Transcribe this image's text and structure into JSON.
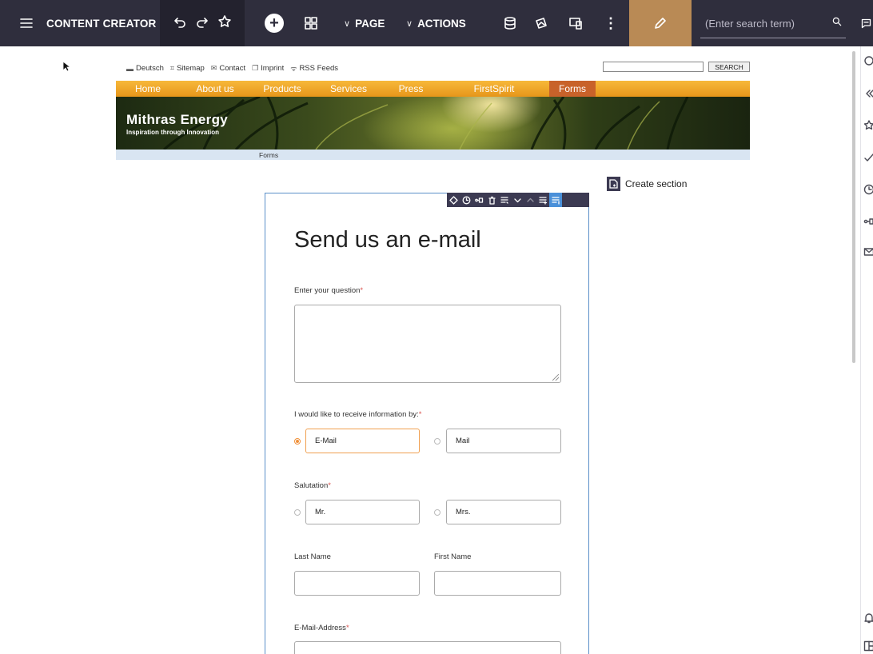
{
  "toolbar": {
    "app_title": "CONTENT CREATOR",
    "page_menu": "PAGE",
    "actions_menu": "ACTIONS",
    "search_placeholder": "(Enter search term)",
    "plus_label": "+",
    "more_label": "⋮",
    "chevron": "∨"
  },
  "site": {
    "meta_nav": [
      "Deutsch",
      "Sitemap",
      "Contact",
      "Imprint",
      "RSS Feeds"
    ],
    "search_button": "SEARCH",
    "nav": [
      "Home",
      "About us",
      "Products",
      "Services",
      "Press",
      "FirstSpirit",
      "Forms"
    ],
    "active_nav": "Forms",
    "brand_name": "Mithras Energy",
    "brand_slogan": "Inspiration through Innovation",
    "breadcrumb": "Forms"
  },
  "create_section": "Create section",
  "form": {
    "title": "Send us an e-mail",
    "question_label": "Enter your question",
    "info_label": "I would like to receive information by:",
    "info_options": [
      "E-Mail",
      "Mail"
    ],
    "info_selected": "E-Mail",
    "salutation_label": "Salutation",
    "salutation_options": [
      "Mr.",
      "Mrs."
    ],
    "last_name_label": "Last Name",
    "first_name_label": "First Name",
    "email_label": "E-Mail-Address",
    "required_mark": "*"
  },
  "colors": {
    "toolbar_bg": "#2f2e3d",
    "edit_accent": "#b98a55",
    "nav_orange": "#f0a32a",
    "nav_active": "#c8622a",
    "selection_blue": "#4a90d9",
    "radio_orange": "#f0913a"
  }
}
